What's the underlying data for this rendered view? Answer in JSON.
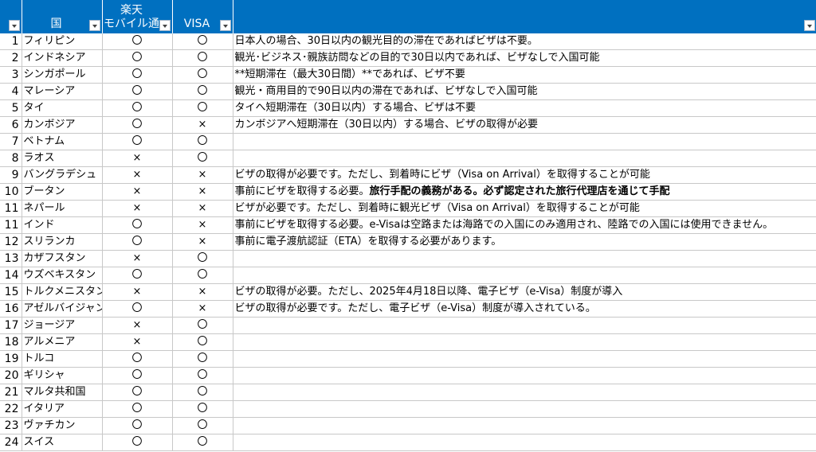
{
  "header": {
    "num": "",
    "country": "国",
    "mobile_line1": "楽天",
    "mobile_line2": "モバイル通",
    "visa": "VISA",
    "note": ""
  },
  "rows": [
    {
      "num": "1",
      "country": "フィリピン",
      "mobile": "〇",
      "visa": "〇",
      "note": "日本人の場合、30日以内の観光目的の滞在であればビザは不要。",
      "note_bold": ""
    },
    {
      "num": "2",
      "country": "インドネシア",
      "mobile": "〇",
      "visa": "〇",
      "note": "観光･ビジネス･親族訪問などの目的で30日以内であれば、ビザなしで入国可能",
      "note_bold": ""
    },
    {
      "num": "3",
      "country": "シンガポール",
      "mobile": "〇",
      "visa": "〇",
      "note": "**短期滞在（最大30日間）**であれば、ビザ不要",
      "note_bold": ""
    },
    {
      "num": "4",
      "country": "マレーシア",
      "mobile": "〇",
      "visa": "〇",
      "note": "観光・商用目的で90日以内の滞在であれば、ビザなしで入国可能",
      "note_bold": ""
    },
    {
      "num": "5",
      "country": "タイ",
      "mobile": "〇",
      "visa": "〇",
      "note": "タイへ短期滞在（30日以内）する場合、ビザは不要",
      "note_bold": ""
    },
    {
      "num": "6",
      "country": "カンボジア",
      "mobile": "〇",
      "visa": "×",
      "note": "カンボジアへ短期滞在（30日以内）する場合、ビザの取得が必要",
      "note_bold": ""
    },
    {
      "num": "7",
      "country": "ベトナム",
      "mobile": "〇",
      "visa": "〇",
      "note": "",
      "note_bold": ""
    },
    {
      "num": "8",
      "country": "ラオス",
      "mobile": "×",
      "visa": "〇",
      "note": "",
      "note_bold": ""
    },
    {
      "num": "9",
      "country": "バングラデシュ",
      "mobile": "×",
      "visa": "×",
      "note": "ビザの取得が必要です。ただし、到着時にビザ（Visa on Arrival）を取得することが可能",
      "note_bold": ""
    },
    {
      "num": "10",
      "country": "ブータン",
      "mobile": "×",
      "visa": "×",
      "note": "事前にビザを取得する必要。",
      "note_bold": "旅行手配の義務がある。必ず認定された旅行代理店を通じて手配"
    },
    {
      "num": "11",
      "country": "ネパール",
      "mobile": "×",
      "visa": "×",
      "note": "ビザが必要です。ただし、到着時に観光ビザ（Visa on Arrival）を取得することが可能",
      "note_bold": ""
    },
    {
      "num": "11",
      "country": "インド",
      "mobile": "〇",
      "visa": "×",
      "note": "事前にビザを取得する必要。e-Visaは空路または海路での入国にのみ適用され、陸路での入国には使用できません。",
      "note_bold": ""
    },
    {
      "num": "12",
      "country": "スリランカ",
      "mobile": "〇",
      "visa": "×",
      "note": "事前に電子渡航認証（ETA）を取得する必要があります。",
      "note_bold": ""
    },
    {
      "num": "13",
      "country": "カザフスタン",
      "mobile": "×",
      "visa": "〇",
      "note": "",
      "note_bold": ""
    },
    {
      "num": "14",
      "country": "ウズベキスタン",
      "mobile": "〇",
      "visa": "〇",
      "note": "",
      "note_bold": ""
    },
    {
      "num": "15",
      "country": "トルクメニスタン",
      "mobile": "×",
      "visa": "×",
      "note": "ビザの取得が必要。ただし、2025年4月18日以降、電子ビザ（e-Visa）制度が導入",
      "note_bold": ""
    },
    {
      "num": "16",
      "country": "アゼルバイジャン",
      "mobile": "〇",
      "visa": "×",
      "note": "ビザの取得が必要です。ただし、電子ビザ（e-Visa）制度が導入されている。",
      "note_bold": ""
    },
    {
      "num": "17",
      "country": "ジョージア",
      "mobile": "×",
      "visa": "〇",
      "note": "",
      "note_bold": ""
    },
    {
      "num": "18",
      "country": "アルメニア",
      "mobile": "×",
      "visa": "〇",
      "note": "",
      "note_bold": ""
    },
    {
      "num": "19",
      "country": "トルコ",
      "mobile": "〇",
      "visa": "〇",
      "note": "",
      "note_bold": ""
    },
    {
      "num": "20",
      "country": "ギリシャ",
      "mobile": "〇",
      "visa": "〇",
      "note": "",
      "note_bold": ""
    },
    {
      "num": "21",
      "country": "マルタ共和国",
      "mobile": "〇",
      "visa": "〇",
      "note": "",
      "note_bold": ""
    },
    {
      "num": "22",
      "country": "イタリア",
      "mobile": "〇",
      "visa": "〇",
      "note": "",
      "note_bold": ""
    },
    {
      "num": "23",
      "country": "ヴァチカン",
      "mobile": "〇",
      "visa": "〇",
      "note": "",
      "note_bold": ""
    },
    {
      "num": "24",
      "country": "スイス",
      "mobile": "〇",
      "visa": "〇",
      "note": "",
      "note_bold": ""
    }
  ],
  "colors": {
    "header_bg": "#0070c0",
    "header_text": "#ffffff",
    "grid": "#c8c8c8"
  },
  "icons": {
    "filter": "dropdown-arrow-icon"
  }
}
